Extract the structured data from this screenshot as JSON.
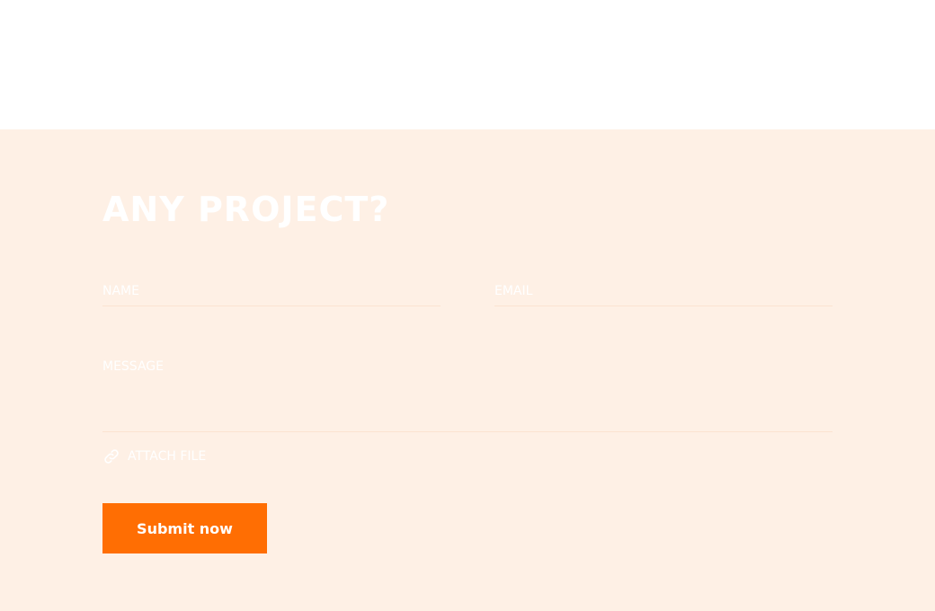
{
  "contact_form": {
    "heading": "ANY PROJECT?",
    "name_placeholder": "NAME",
    "email_placeholder": "EMAIL",
    "message_placeholder": "MESSAGE",
    "attach_label": "ATTACH FILE",
    "submit_label": "Submit now"
  },
  "colors": {
    "section_background": "#fef0e5",
    "accent": "#ff6e03",
    "text_on_light": "#ffffff"
  },
  "icons": {
    "attach": "paperclip-icon"
  }
}
